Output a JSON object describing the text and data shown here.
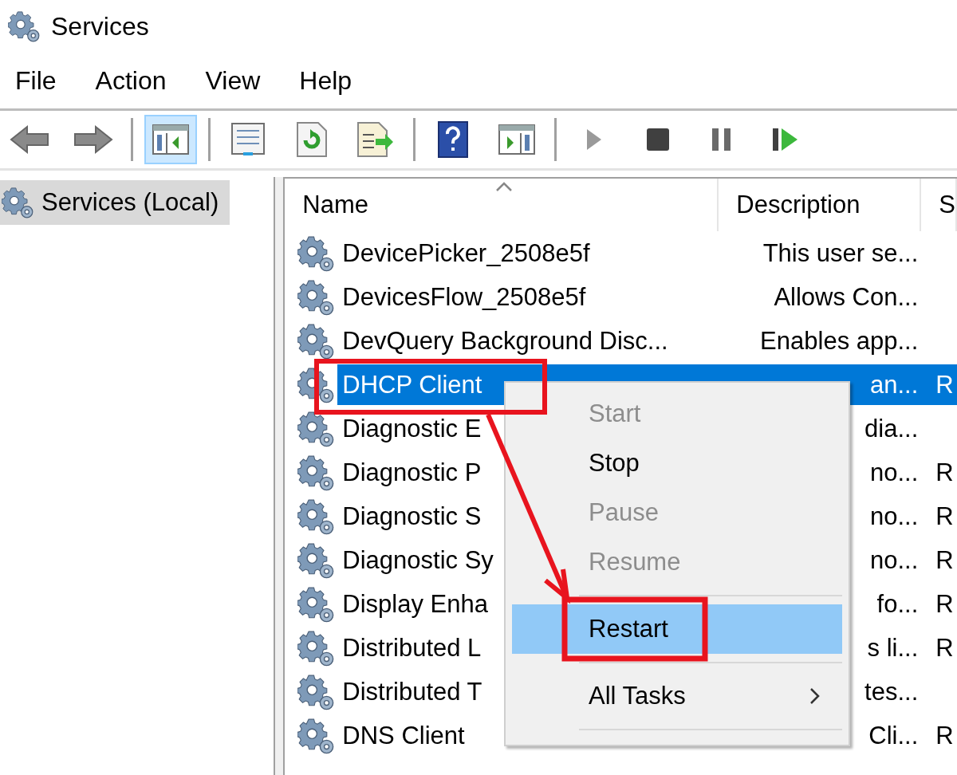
{
  "window": {
    "title": "Services"
  },
  "menu_bar": [
    "File",
    "Action",
    "View",
    "Help"
  ],
  "toolbar": [
    {
      "kind": "back",
      "pressed": false
    },
    {
      "kind": "forward",
      "pressed": false
    },
    {
      "kind": "sep"
    },
    {
      "kind": "tree",
      "pressed": true
    },
    {
      "kind": "sep"
    },
    {
      "kind": "properties",
      "pressed": false
    },
    {
      "kind": "refresh",
      "pressed": false
    },
    {
      "kind": "export",
      "pressed": false
    },
    {
      "kind": "sep"
    },
    {
      "kind": "help",
      "pressed": false
    },
    {
      "kind": "pane",
      "pressed": false
    },
    {
      "kind": "sep"
    },
    {
      "kind": "play",
      "pressed": false
    },
    {
      "kind": "stop",
      "pressed": false
    },
    {
      "kind": "pause",
      "pressed": false
    },
    {
      "kind": "resume",
      "pressed": false
    }
  ],
  "tree": {
    "label": "Services (Local)",
    "selected": true
  },
  "table": {
    "columns": [
      "Name",
      "Description",
      "S"
    ],
    "rows": [
      {
        "name": "DevicePicker_2508e5f",
        "description": "This user se...",
        "selected": false
      },
      {
        "name": "DevicesFlow_2508e5f",
        "description": "Allows Con...",
        "selected": false
      },
      {
        "name": "DevQuery Background Disc...",
        "description": "Enables app...",
        "selected": false
      },
      {
        "name": "DHCP Client",
        "description": "an...",
        "column_3": "R",
        "selected": true
      },
      {
        "name": "Diagnostic E",
        "description": "dia...",
        "selected": false
      },
      {
        "name": "Diagnostic P",
        "description": "no...",
        "column_3": "R",
        "selected": false
      },
      {
        "name": "Diagnostic S",
        "description": "no...",
        "column_3": "R",
        "selected": false
      },
      {
        "name": "Diagnostic Sy",
        "description": "no...",
        "column_3": "R",
        "selected": false
      },
      {
        "name": "Display Enha",
        "description": "fo...",
        "column_3": "R",
        "selected": false
      },
      {
        "name": "Distributed L",
        "description": "s li...",
        "column_3": "R",
        "selected": false
      },
      {
        "name": "Distributed T",
        "description": "tes...",
        "selected": false
      },
      {
        "name": "DNS Client",
        "description": "Cli...",
        "column_3": "R",
        "selected": false
      }
    ]
  },
  "context_menu": [
    {
      "kind": "item",
      "label": "Start",
      "disabled": true,
      "selected": false
    },
    {
      "kind": "item",
      "label": "Stop",
      "disabled": false,
      "selected": false
    },
    {
      "kind": "item",
      "label": "Pause",
      "disabled": true,
      "selected": false
    },
    {
      "kind": "item",
      "label": "Resume",
      "disabled": true,
      "selected": false
    },
    {
      "kind": "separator"
    },
    {
      "kind": "item",
      "label": "Restart",
      "disabled": false,
      "selected": true
    },
    {
      "kind": "separator"
    },
    {
      "kind": "submenu",
      "label": "All Tasks",
      "disabled": false,
      "selected": false
    },
    {
      "kind": "separator"
    }
  ]
}
